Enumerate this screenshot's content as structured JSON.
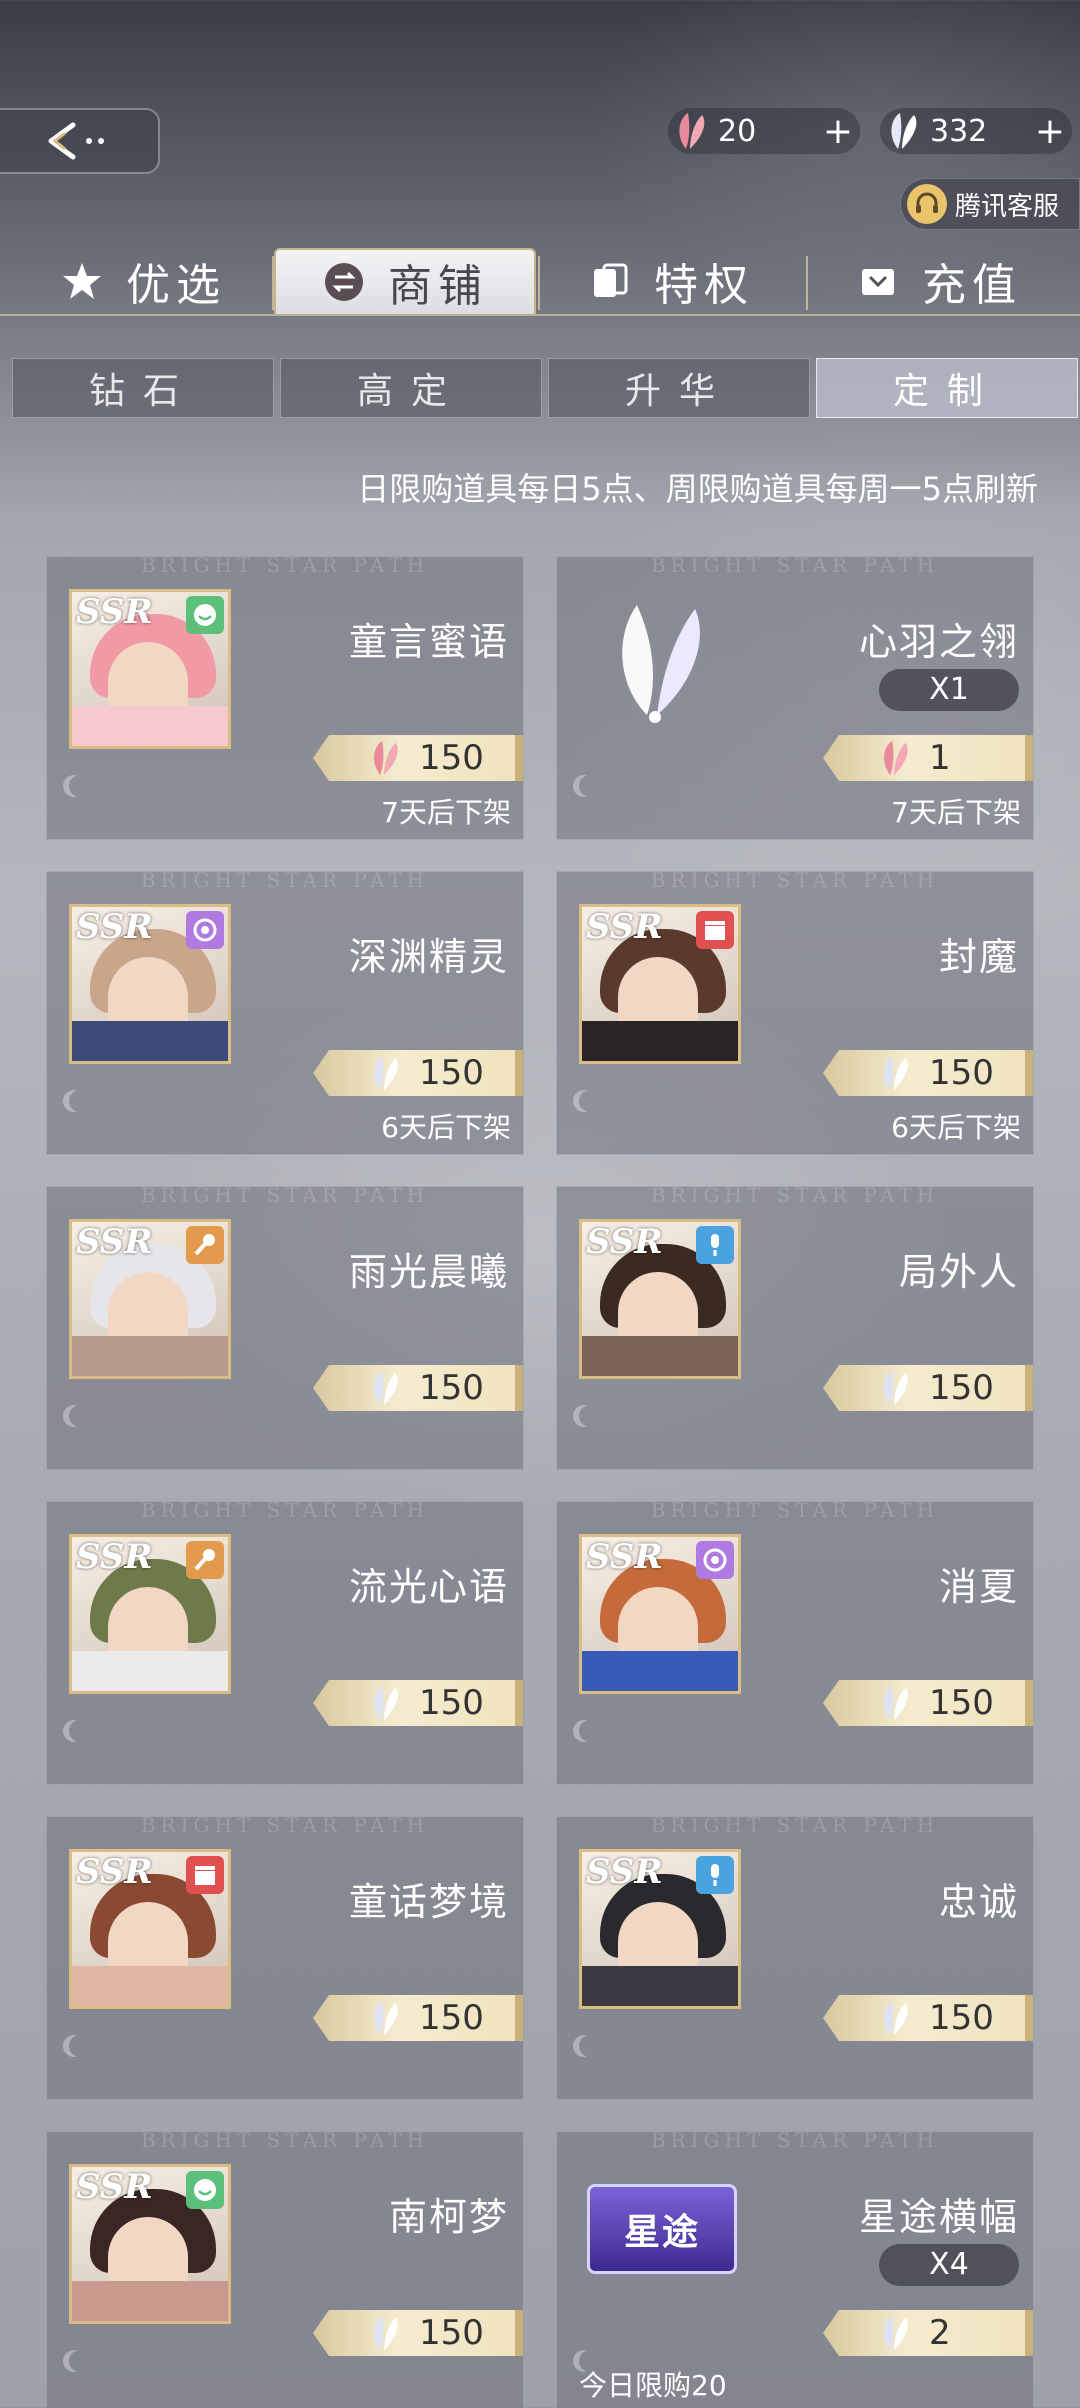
{
  "header": {
    "currency_pink_amount": "20",
    "currency_white_amount": "332",
    "plus_symbol": "+",
    "customer_service": "腾讯客服"
  },
  "main_tabs": [
    {
      "label": "优选",
      "icon": "star-icon"
    },
    {
      "label": "商铺",
      "icon": "exchange-icon"
    },
    {
      "label": "特权",
      "icon": "card-icon"
    },
    {
      "label": "充值",
      "icon": "wallet-icon"
    }
  ],
  "sub_tabs": [
    {
      "label": "钻石"
    },
    {
      "label": "高定"
    },
    {
      "label": "升华"
    },
    {
      "label": "定制"
    }
  ],
  "notice": "日限购道具每日5点、周限购道具每周一5点刷新",
  "watermark": "BRIGHT STAR PATH",
  "items": [
    {
      "name": "童言蜜语",
      "price": "150",
      "currency": "pink-feather",
      "expiry": "7天后下架",
      "badge": "smile-icon"
    },
    {
      "name": "心羽之翎",
      "qty": "X1",
      "price": "1",
      "currency": "pink-feather",
      "expiry": "7天后下架"
    },
    {
      "name": "深渊精灵",
      "price": "150",
      "currency": "white-feather",
      "expiry": "6天后下架",
      "badge": "film-reel-icon"
    },
    {
      "name": "封魔",
      "price": "150",
      "currency": "white-feather",
      "expiry": "6天后下架",
      "badge": "clapperboard-icon"
    },
    {
      "name": "雨光晨曦",
      "price": "150",
      "currency": "white-feather",
      "badge": "microphone-icon"
    },
    {
      "name": "局外人",
      "price": "150",
      "currency": "white-feather",
      "badge": "studio-mic-icon"
    },
    {
      "name": "流光心语",
      "price": "150",
      "currency": "white-feather",
      "badge": "microphone-icon"
    },
    {
      "name": "消夏",
      "price": "150",
      "currency": "white-feather",
      "badge": "film-reel-icon"
    },
    {
      "name": "童话梦境",
      "price": "150",
      "currency": "white-feather",
      "badge": "clapperboard-icon"
    },
    {
      "name": "忠诚",
      "price": "150",
      "currency": "white-feather",
      "badge": "studio-mic-icon"
    },
    {
      "name": "南柯梦",
      "price": "150",
      "currency": "white-feather",
      "badge": "smile-icon"
    },
    {
      "name": "星途横幅",
      "qty": "X4",
      "price": "2",
      "currency": "white-feather",
      "limit": "今日限购20",
      "art_text": "星途"
    }
  ],
  "ssr_label": "SSR",
  "colors": {
    "accent_gold": "#d9bd84",
    "pink_feather": "#e88a9a",
    "badge_green": "#5cbf7a",
    "badge_purple": "#b07be0",
    "badge_red": "#e05050",
    "badge_orange": "#e39a4c",
    "badge_blue": "#4aa3df"
  }
}
